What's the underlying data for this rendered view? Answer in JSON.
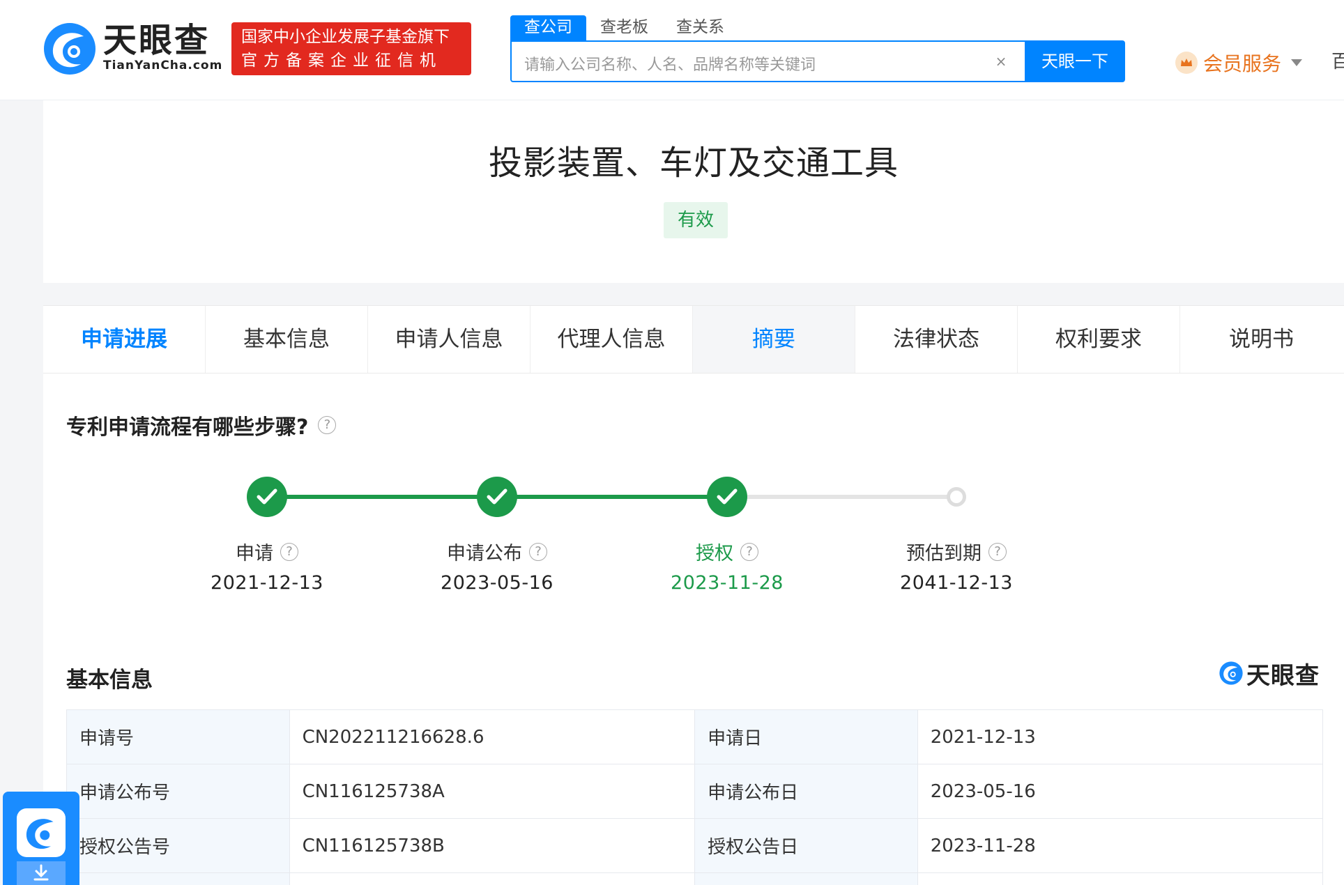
{
  "header": {
    "logo_text": "天眼查",
    "logo_domain": "TianYanCha.com",
    "badge_line1": "国家中小企业发展子基金旗下",
    "badge_line2": "官方备案企业征信机构",
    "search_tabs": [
      "查公司",
      "查老板",
      "查关系"
    ],
    "search_placeholder": "请输入公司名称、人名、品牌名称等关键词",
    "search_clear": "×",
    "search_button": "天眼一下",
    "vip_label": "会员服务",
    "right_clip": "百"
  },
  "title": {
    "text": "投影装置、车灯及交通工具",
    "status": "有效"
  },
  "tabs": [
    "申请进展",
    "基本信息",
    "申请人信息",
    "代理人信息",
    "摘要",
    "法律状态",
    "权利要求",
    "说明书"
  ],
  "progress": {
    "question": "专利申请流程有哪些步骤?",
    "help": "?",
    "steps": [
      {
        "label": "申请",
        "date": "2021-12-13",
        "done": true
      },
      {
        "label": "申请公布",
        "date": "2023-05-16",
        "done": true
      },
      {
        "label": "授权",
        "date": "2023-11-28",
        "done": true,
        "current": true
      },
      {
        "label": "预估到期",
        "date": "2041-12-13",
        "done": false
      }
    ]
  },
  "basic": {
    "title": "基本信息",
    "brand": "天眼查",
    "rows": [
      {
        "k1": "申请号",
        "v1": "CN202211216628.6",
        "k2": "申请日",
        "v2": "2021-12-13"
      },
      {
        "k1": "申请公布号",
        "v1": "CN116125738A",
        "k2": "申请公布日",
        "v2": "2023-05-16"
      },
      {
        "k1": "授权公告号",
        "v1": "CN116125738B",
        "k2": "授权公告日",
        "v2": "2023-11-28"
      },
      {
        "k1": "",
        "v1": "",
        "k2": "",
        "v2": ""
      }
    ]
  },
  "colors": {
    "brand_blue": "#0084ff",
    "success_green": "#1c9a4a",
    "badge_red": "#e2291f",
    "vip_orange": "#e8731e"
  }
}
